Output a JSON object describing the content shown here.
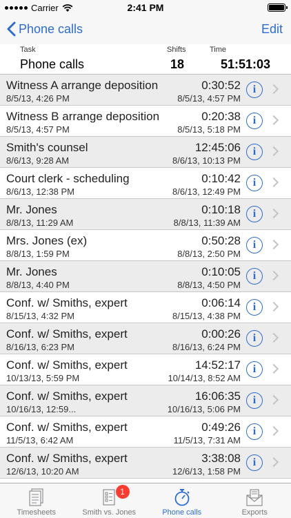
{
  "status_bar": {
    "carrier": "Carrier",
    "time": "2:41 PM"
  },
  "nav": {
    "back_label": "Phone calls",
    "edit_label": "Edit"
  },
  "summary": {
    "task_header": "Task",
    "shifts_header": "Shifts",
    "time_header": "Time",
    "task": "Phone calls",
    "shifts": "18",
    "time": "51:51:03"
  },
  "rows": [
    {
      "title": "Witness A arrange deposition",
      "duration": "0:30:52",
      "start": "8/5/13, 4:26 PM",
      "end": "8/5/13, 4:57 PM"
    },
    {
      "title": "Witness B arrange deposition",
      "duration": "0:20:38",
      "start": "8/5/13, 4:57 PM",
      "end": "8/5/13, 5:18 PM"
    },
    {
      "title": "Smith's counsel",
      "duration": "12:45:06",
      "start": "8/6/13, 9:28 AM",
      "end": "8/6/13, 10:13 PM"
    },
    {
      "title": "Court clerk - scheduling",
      "duration": "0:10:42",
      "start": "8/6/13, 12:38 PM",
      "end": "8/6/13, 12:49 PM"
    },
    {
      "title": "Mr. Jones",
      "duration": "0:10:18",
      "start": "8/8/13, 11:29 AM",
      "end": "8/8/13, 11:39 AM"
    },
    {
      "title": "Mrs. Jones (ex)",
      "duration": "0:50:28",
      "start": "8/8/13, 1:59 PM",
      "end": "8/8/13, 2:50 PM"
    },
    {
      "title": "Mr. Jones",
      "duration": "0:10:05",
      "start": "8/8/13, 4:40 PM",
      "end": "8/8/13, 4:50 PM"
    },
    {
      "title": "Conf. w/ Smiths, expert",
      "duration": "0:06:14",
      "start": "8/15/13, 4:32 PM",
      "end": "8/15/13, 4:38 PM"
    },
    {
      "title": "Conf. w/ Smiths, expert",
      "duration": "0:00:26",
      "start": "8/16/13, 6:23 PM",
      "end": "8/16/13, 6:24 PM"
    },
    {
      "title": "Conf. w/ Smiths, expert",
      "duration": "14:52:17",
      "start": "10/13/13, 5:59 PM",
      "end": "10/14/13, 8:52 AM"
    },
    {
      "title": "Conf. w/ Smiths, expert",
      "duration": "16:06:35",
      "start": "10/16/13, 12:59...",
      "end": "10/16/13, 5:06 PM"
    },
    {
      "title": "Conf. w/ Smiths, expert",
      "duration": "0:49:26",
      "start": "11/5/13, 6:42 AM",
      "end": "11/5/13, 7:31 AM"
    },
    {
      "title": "Conf. w/ Smiths, expert",
      "duration": "3:38:08",
      "start": "12/6/13, 10:20 AM",
      "end": "12/6/13, 1:58 PM"
    }
  ],
  "tabs": [
    {
      "label": "Timesheets",
      "icon": "timesheets-icon"
    },
    {
      "label": "Smith vs. Jones",
      "icon": "document-icon",
      "badge": "1"
    },
    {
      "label": "Phone calls",
      "icon": "stopwatch-icon",
      "active": true
    },
    {
      "label": "Exports",
      "icon": "export-envelope-icon"
    }
  ],
  "colors": {
    "accent": "#2d6bd1",
    "badge": "#ff3b30"
  }
}
